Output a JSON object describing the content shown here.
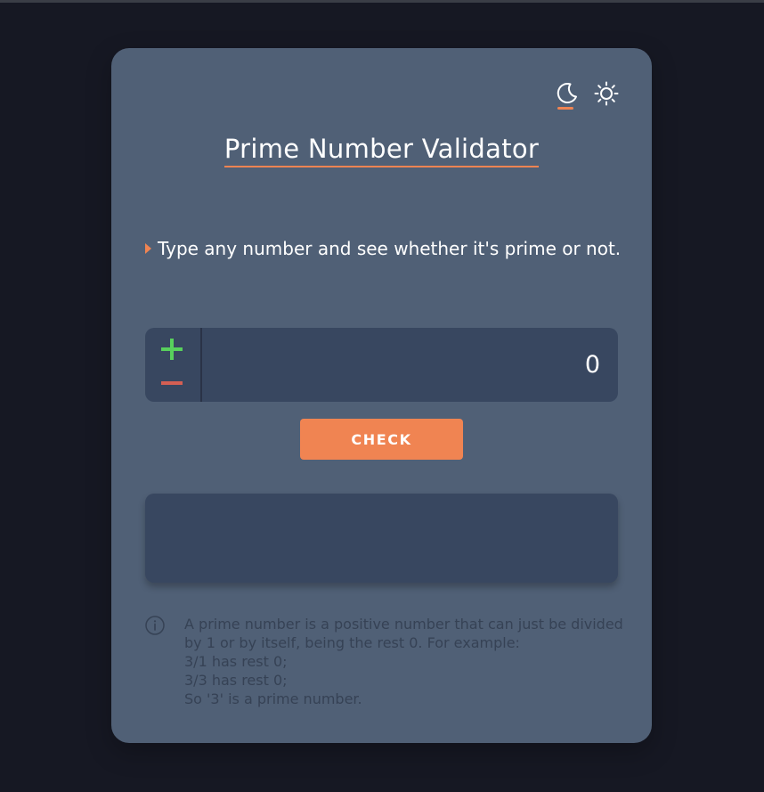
{
  "theme_toggle": {
    "moon_icon": "moon-icon",
    "sun_icon": "sun-icon",
    "active": "moon"
  },
  "title": "Prime Number Validator",
  "instruction": "Type any number and see whether it's prime or not.",
  "number_input": {
    "value": "0",
    "plus_icon": "plus-icon",
    "minus_icon": "minus-icon"
  },
  "check_button": {
    "label": "CHECK"
  },
  "result": {
    "text": ""
  },
  "info": {
    "icon": "info-icon",
    "lines": [
      "A prime number is a positive number that can just be divided by 1 or by itself, being the rest 0. For example:",
      "3/1 has rest 0;",
      "3/3 has rest 0;",
      "So '3' is a prime number."
    ]
  },
  "colors": {
    "page_background": "#161823",
    "card_background": "#506076",
    "panel_background": "#384760",
    "accent": "#f08452",
    "plus": "#58d05c",
    "minus": "#d45f53",
    "muted_text": "#364255"
  }
}
